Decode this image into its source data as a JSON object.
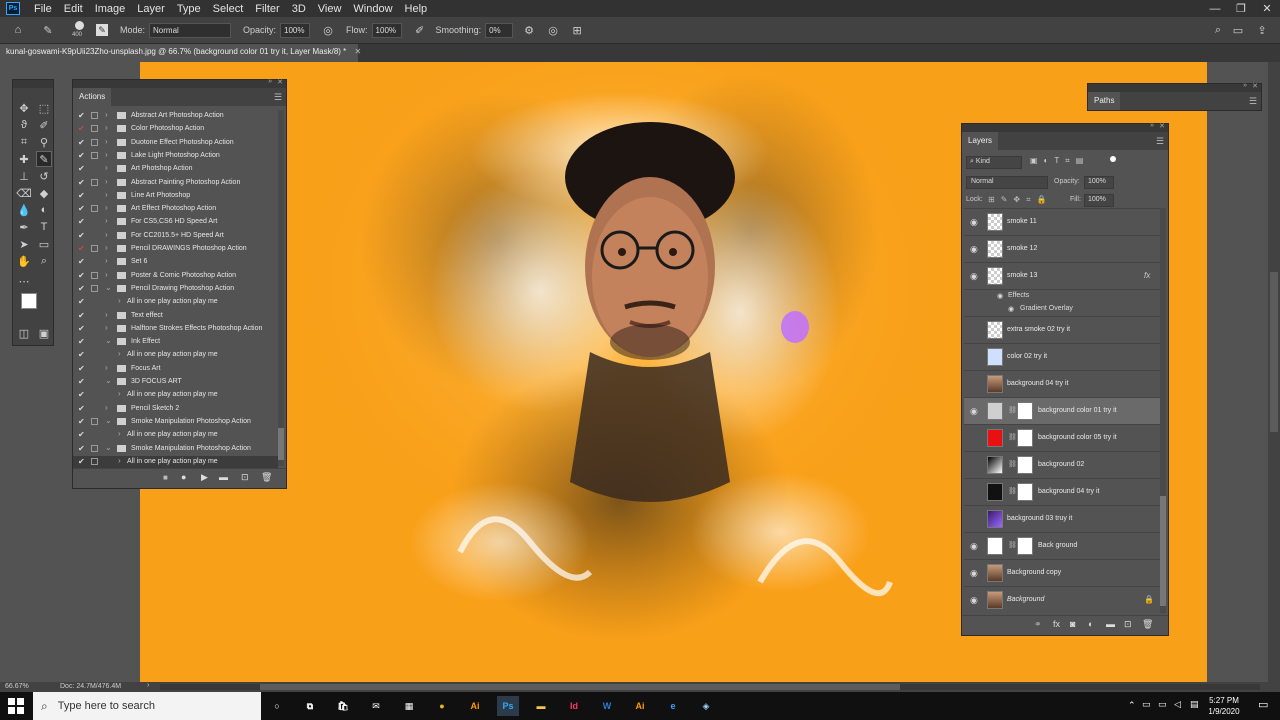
{
  "app": {
    "logo_text": "Ps"
  },
  "menu": [
    "File",
    "Edit",
    "Image",
    "Layer",
    "Type",
    "Select",
    "Filter",
    "3D",
    "View",
    "Window",
    "Help"
  ],
  "window_controls": {
    "minimize": "—",
    "maximize": "❐",
    "close": "✕"
  },
  "options": {
    "brush_size": "400",
    "mode_label": "Mode:",
    "mode_value": "Normal",
    "opacity_label": "Opacity:",
    "opacity_value": "100%",
    "flow_label": "Flow:",
    "flow_value": "100%",
    "smoothing_label": "Smoothing:",
    "smoothing_value": "0%"
  },
  "document": {
    "tab_title": "kunal-goswami-K9pUii23Zho-unsplash.jpg @ 66.7% (background color 01 try it, Layer Mask/8) *",
    "close": "✕"
  },
  "actions_panel": {
    "title": "Actions",
    "items": [
      {
        "label": "Abstract Art Photoshop Action",
        "check_red": false,
        "dialog": true,
        "expanded": false,
        "sub": false
      },
      {
        "label": "Color Photoshop Action",
        "check_red": true,
        "dialog": true,
        "expanded": false,
        "sub": false
      },
      {
        "label": "Duotone Effect Photoshop Action",
        "check_red": false,
        "dialog": true,
        "expanded": false,
        "sub": false
      },
      {
        "label": "Lake Light Photoshop Action",
        "check_red": false,
        "dialog": true,
        "expanded": false,
        "sub": false
      },
      {
        "label": "Art Photshop Action",
        "check_red": false,
        "dialog": false,
        "expanded": false,
        "sub": false
      },
      {
        "label": "Abstract Painting Photoshop Action",
        "check_red": false,
        "dialog": true,
        "expanded": false,
        "sub": false
      },
      {
        "label": "Line Art Photoshop",
        "check_red": false,
        "dialog": false,
        "expanded": false,
        "sub": false
      },
      {
        "label": "Art Effect Photoshop Action",
        "check_red": false,
        "dialog": true,
        "expanded": false,
        "sub": false
      },
      {
        "label": "For CS5,CS6 HD Speed Art",
        "check_red": false,
        "dialog": false,
        "expanded": false,
        "sub": false
      },
      {
        "label": "For CC2015.5+ HD Speed Art",
        "check_red": false,
        "dialog": false,
        "expanded": false,
        "sub": false
      },
      {
        "label": "Pencil DRAWINGS Photoshop Action",
        "check_red": true,
        "dialog": true,
        "expanded": false,
        "sub": false
      },
      {
        "label": "Set 6",
        "check_red": false,
        "dialog": false,
        "expanded": false,
        "sub": false
      },
      {
        "label": "Poster & Comic Photoshop Action",
        "check_red": false,
        "dialog": true,
        "expanded": false,
        "sub": false
      },
      {
        "label": "Pencil Drawing Photoshop Action",
        "check_red": false,
        "dialog": true,
        "expanded": true,
        "sub": false
      },
      {
        "label": "All in one play action play me",
        "check_red": false,
        "dialog": false,
        "expanded": false,
        "sub": true
      },
      {
        "label": "Text effect",
        "check_red": false,
        "dialog": false,
        "expanded": false,
        "sub": false
      },
      {
        "label": "Halftone Strokes Effects Photoshop Action",
        "check_red": false,
        "dialog": false,
        "expanded": false,
        "sub": false
      },
      {
        "label": "Ink Effect",
        "check_red": false,
        "dialog": false,
        "expanded": true,
        "sub": false
      },
      {
        "label": "All in one play action play me",
        "check_red": false,
        "dialog": false,
        "expanded": false,
        "sub": true
      },
      {
        "label": "Focus Art",
        "check_red": false,
        "dialog": false,
        "expanded": false,
        "sub": false
      },
      {
        "label": "3D FOCUS ART",
        "check_red": false,
        "dialog": false,
        "expanded": true,
        "sub": false
      },
      {
        "label": "All in one play action play me",
        "check_red": false,
        "dialog": false,
        "expanded": false,
        "sub": true
      },
      {
        "label": "Pencil Sketch 2",
        "check_red": false,
        "dialog": false,
        "expanded": false,
        "sub": false
      },
      {
        "label": "Smoke Manipulation Photoshop Action",
        "check_red": false,
        "dialog": true,
        "expanded": true,
        "sub": false
      },
      {
        "label": "All in one play action play me",
        "check_red": false,
        "dialog": false,
        "expanded": false,
        "sub": true
      },
      {
        "label": "Smoke Manipulation Photoshop Action",
        "check_red": false,
        "dialog": true,
        "expanded": true,
        "sub": false
      },
      {
        "label": "All in one play action play me",
        "check_red": false,
        "dialog": true,
        "expanded": false,
        "sub": true,
        "selected": true
      }
    ]
  },
  "paths_panel": {
    "title": "Paths"
  },
  "layers_panel": {
    "title": "Layers",
    "filter_value": "Kind",
    "blend_mode": "Normal",
    "opacity_label": "Opacity:",
    "opacity_value": "100%",
    "lock_label": "Lock:",
    "fill_label": "Fill:",
    "fill_value": "100%",
    "fx_label": "fx",
    "effects_label": "Effects",
    "gradient_overlay_label": "Gradient Overlay",
    "layers": [
      {
        "name": "smoke 11",
        "visible": true,
        "thumb": "checker",
        "mask": false
      },
      {
        "name": "smoke 12",
        "visible": true,
        "thumb": "checker",
        "mask": false
      },
      {
        "name": "smoke 13",
        "visible": true,
        "thumb": "checker",
        "mask": false,
        "fx": true
      },
      {
        "name": "extra smoke 02 try it",
        "visible": false,
        "thumb": "checker",
        "mask": false
      },
      {
        "name": "color 02 try it",
        "visible": false,
        "thumb": "checker-blue",
        "mask": false
      },
      {
        "name": "background 04 try it",
        "visible": false,
        "thumb": "photo",
        "mask": false
      },
      {
        "name": "background color 01 try it",
        "visible": true,
        "thumb": "gray",
        "mask": true,
        "selected": true
      },
      {
        "name": "background color 05 try it",
        "visible": false,
        "thumb": "#e81010",
        "mask": true
      },
      {
        "name": "background 02",
        "visible": false,
        "thumb": "gradient",
        "mask": true
      },
      {
        "name": "background 04 try it",
        "visible": false,
        "thumb": "#111111",
        "mask": true
      },
      {
        "name": "background 03 truy it",
        "visible": false,
        "thumb": "purple",
        "mask": false
      },
      {
        "name": "Back ground",
        "visible": true,
        "thumb": "#ffffff",
        "mask": true
      },
      {
        "name": "Background copy",
        "visible": true,
        "thumb": "photo",
        "mask": false
      },
      {
        "name": "Background",
        "visible": true,
        "thumb": "photo",
        "mask": false,
        "locked": true,
        "italic": true
      }
    ]
  },
  "status": {
    "zoom": "66.67%",
    "doc_info": "Doc: 24.7M/476.4M"
  },
  "taskbar": {
    "search_placeholder": "Type here to search",
    "time": "5:27 PM",
    "date": "1/9/2020",
    "apps": [
      {
        "name": "cortana-icon",
        "glyph": "○",
        "color": "#ffffff"
      },
      {
        "name": "task-view-icon",
        "glyph": "⧉",
        "color": "#ffffff"
      },
      {
        "name": "store-icon",
        "glyph": "🛍",
        "color": "#ffffff"
      },
      {
        "name": "mail-icon",
        "glyph": "✉",
        "color": "#ffffff"
      },
      {
        "name": "calculator-icon",
        "glyph": "▦",
        "color": "#ffffff"
      },
      {
        "name": "chrome-icon",
        "glyph": "●",
        "color": "#e8b71a"
      },
      {
        "name": "illustrator-icon",
        "glyph": "Ai",
        "color": "#ff9a00"
      },
      {
        "name": "photoshop-icon",
        "glyph": "Ps",
        "color": "#31a8ff"
      },
      {
        "name": "file-explorer-icon",
        "glyph": "▬",
        "color": "#f5c84c"
      },
      {
        "name": "indesign-icon",
        "glyph": "Id",
        "color": "#ff3366"
      },
      {
        "name": "word-icon",
        "glyph": "W",
        "color": "#2b7cd3"
      },
      {
        "name": "illustrator-icon-2",
        "glyph": "Ai",
        "color": "#ff9a00"
      },
      {
        "name": "edge-icon",
        "glyph": "e",
        "color": "#3aa0ff"
      },
      {
        "name": "app-icon",
        "glyph": "◈",
        "color": "#9fd7ff"
      }
    ]
  },
  "colors": {
    "canvas_bg": "#f9a019",
    "panel_bg": "#535353",
    "accent": "#31a8ff"
  }
}
